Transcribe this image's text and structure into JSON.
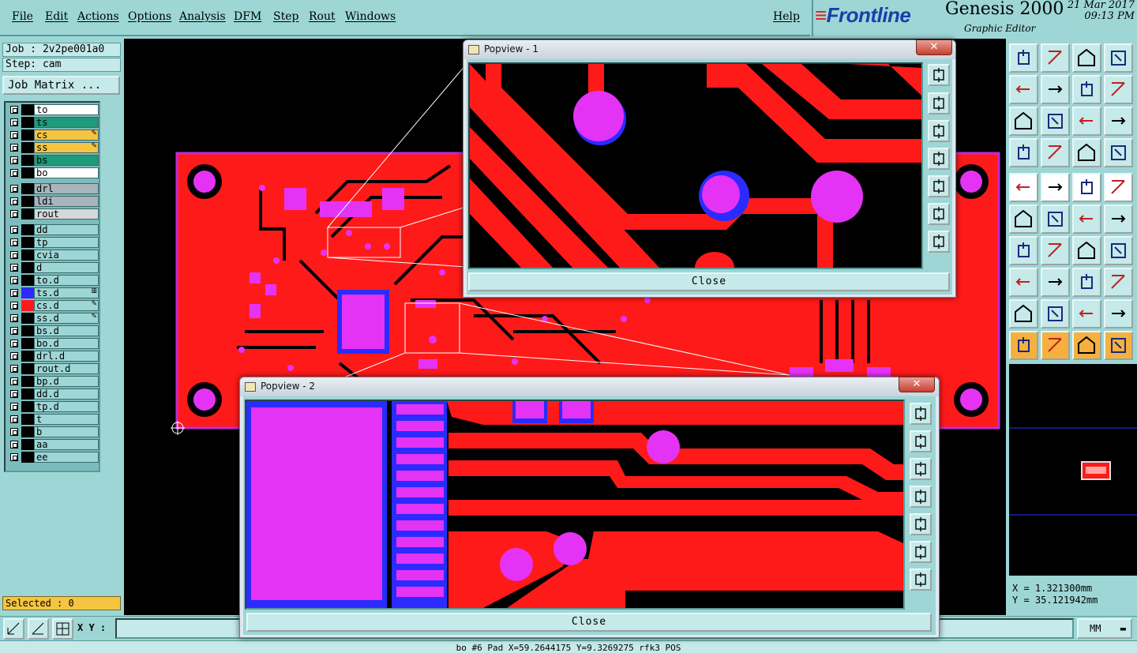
{
  "menu": {
    "file": "File",
    "edit": "Edit",
    "actions": "Actions",
    "options": "Options",
    "analysis": "Analysis",
    "dfm": "DFM",
    "step": "Step",
    "rout": "Rout",
    "windows": "Windows",
    "help": "Help"
  },
  "brand": {
    "logo": "Frontline",
    "product": "Genesis 2000",
    "subtitle": "Graphic Editor",
    "date": "21 Mar 2017",
    "time": "09:13 PM"
  },
  "job": {
    "job_label": "Job : 2v2pe001a0",
    "step_label": "Step: cam",
    "matrix_button": "Job Matrix ..."
  },
  "layers": [
    {
      "name": "to",
      "color": "#ffffff"
    },
    {
      "name": "ts",
      "color": "#1f9a7a"
    },
    {
      "name": "cs",
      "color": "#f5c542",
      "marker": "✎"
    },
    {
      "name": "ss",
      "color": "#f5c542",
      "marker": "✎"
    },
    {
      "name": "bs",
      "color": "#1f9a7a"
    },
    {
      "name": "bo",
      "color": "#ffffff"
    },
    {
      "name": "drl",
      "color": "#a9b4bc"
    },
    {
      "name": "ldi",
      "color": "#a9b4bc"
    },
    {
      "name": "rout",
      "color": "#d4d8da"
    },
    {
      "name": "dd",
      "color": "#9ed6d6"
    },
    {
      "name": "tp",
      "color": "#9ed6d6"
    },
    {
      "name": "cvia",
      "color": "#9ed6d6"
    },
    {
      "name": "d",
      "color": "#9ed6d6"
    },
    {
      "name": "to.d",
      "color": "#9ed6d6"
    },
    {
      "name": "ts.d",
      "color": "#9ed6d6",
      "marker": "⊞"
    },
    {
      "name": "cs.d",
      "color": "#9ed6d6",
      "marker": "✎"
    },
    {
      "name": "ss.d",
      "color": "#9ed6d6",
      "marker": "✎"
    },
    {
      "name": "bs.d",
      "color": "#9ed6d6"
    },
    {
      "name": "bo.d",
      "color": "#9ed6d6"
    },
    {
      "name": "drl.d",
      "color": "#9ed6d6"
    },
    {
      "name": "rout.d",
      "color": "#9ed6d6"
    },
    {
      "name": "bp.d",
      "color": "#9ed6d6"
    },
    {
      "name": "dd.d",
      "color": "#9ed6d6"
    },
    {
      "name": "tp.d",
      "color": "#9ed6d6"
    },
    {
      "name": "t",
      "color": "#9ed6d6"
    },
    {
      "name": "b",
      "color": "#9ed6d6"
    },
    {
      "name": "aa",
      "color": "#9ed6d6"
    },
    {
      "name": "ee",
      "color": "#9ed6d6"
    }
  ],
  "selected": "Selected : 0",
  "popview1": {
    "title": "Popview - 1",
    "close_label": "Close",
    "x": "✕"
  },
  "popview2": {
    "title": "Popview - 2",
    "close_label": "Close",
    "x": "✕"
  },
  "coords": {
    "x": "X = 1.321300mm",
    "y": "Y = 35.121942mm"
  },
  "bottom": {
    "xy_label": "X Y :",
    "xy_value": "",
    "units": "MM"
  },
  "status": "bo #6 Pad X=59.2644175 Y=9.3269275 rfk3 POS",
  "toolbar_icons": [
    "zoom-home-icon",
    "zoom-back-icon",
    "home-icon",
    "grid-snap-icon",
    "pan-left-icon",
    "pan-right-icon",
    "flip-icon",
    "s-curve-icon",
    "fit-icon",
    "center-icon",
    "scale-1-2-icon",
    "help-icon",
    "tool-select-icon",
    "grid-icon",
    "layer-stack-icon",
    "layer-stack-2-icon",
    "pad-icon",
    "color-line-icon",
    "ruler-icon",
    "circle-pad-icon",
    "connect-icon",
    "cross-icon",
    "node-icon",
    "node-2-icon",
    "line-red-icon",
    "line-blue-icon",
    "arc-icon",
    "text-f-icon",
    "move-pad-icon",
    "move-line-icon",
    "resize-icon",
    "shapes-icon",
    "triangle-icon",
    "triangle-2-icon",
    "triangle-3-icon",
    "triangle-4-icon",
    "pointer-icon",
    "pointer-box-icon",
    "pointer-zoom-icon",
    "pointer-node-icon"
  ],
  "colors": {
    "copper": "#ff1a1a",
    "pad": "#e433f5",
    "mask": "#2b2bff",
    "bg": "#000000"
  }
}
